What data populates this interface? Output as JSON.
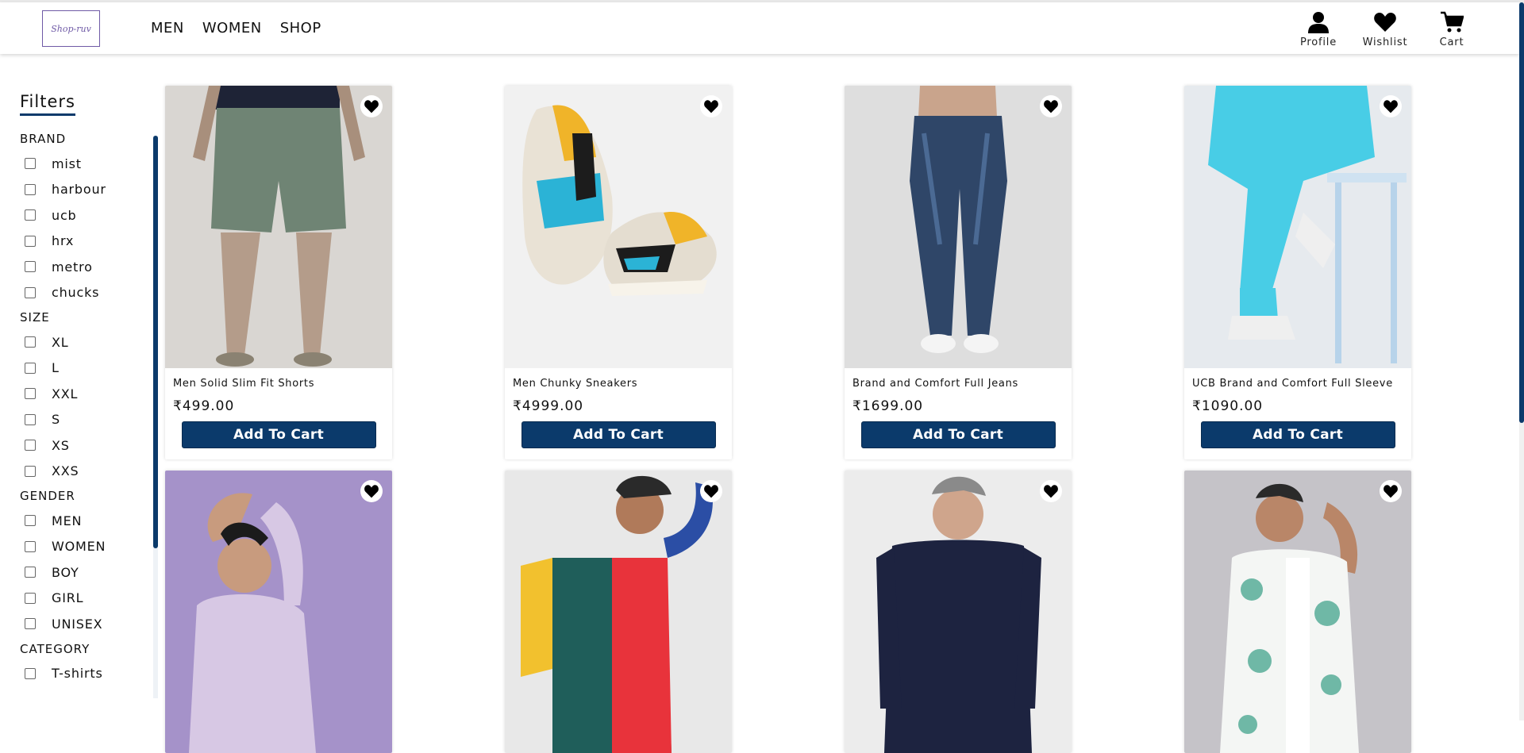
{
  "brand": {
    "logo_text": "Shop-ruv"
  },
  "nav": [
    {
      "label": "MEN"
    },
    {
      "label": "WOMEN"
    },
    {
      "label": "SHOP"
    }
  ],
  "header_icons": {
    "profile": {
      "label": "Profile",
      "icon": "user-icon"
    },
    "wishlist": {
      "label": "Wishlist",
      "icon": "heart-icon"
    },
    "cart": {
      "label": "Cart",
      "icon": "cart-icon"
    }
  },
  "filters": {
    "title": "Filters",
    "groups": [
      {
        "title": "BRAND",
        "options": [
          "mist",
          "harbour",
          "ucb",
          "hrx",
          "metro",
          "chucks"
        ]
      },
      {
        "title": "SIZE",
        "options": [
          "XL",
          "L",
          "XXL",
          "S",
          "XS",
          "XXS"
        ]
      },
      {
        "title": "GENDER",
        "options": [
          "MEN",
          "WOMEN",
          "BOY",
          "GIRL",
          "UNISEX"
        ]
      },
      {
        "title": "CATEGORY",
        "options": [
          "T-shirts"
        ]
      }
    ]
  },
  "products": [
    {
      "name": "Men Solid Slim Fit Shorts",
      "price": "₹499.00",
      "button": "Add To Cart"
    },
    {
      "name": "Men Chunky Sneakers",
      "price": "₹4999.00",
      "button": "Add To Cart"
    },
    {
      "name": "Brand and Comfort Full Jeans",
      "price": "₹1699.00",
      "button": "Add To Cart"
    },
    {
      "name": "UCB Brand and Comfort Full Sleeve",
      "price": "₹1090.00",
      "button": "Add To Cart"
    },
    {
      "name": "",
      "price": "",
      "button": ""
    },
    {
      "name": "",
      "price": "",
      "button": ""
    },
    {
      "name": "",
      "price": "",
      "button": ""
    },
    {
      "name": "",
      "price": "",
      "button": ""
    }
  ],
  "colors": {
    "primary": "#0b3a6b",
    "logo": "#6f5aa6"
  }
}
